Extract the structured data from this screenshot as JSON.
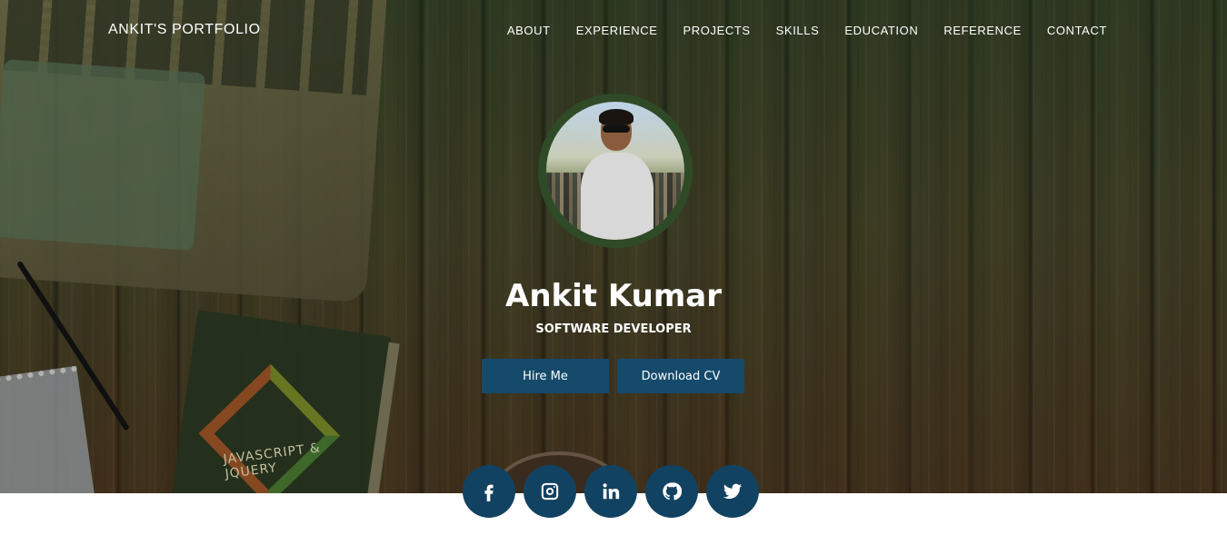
{
  "nav": {
    "brand": "ANKIT'S PORTFOLIO",
    "items": [
      {
        "label": "ABOUT"
      },
      {
        "label": "EXPERIENCE"
      },
      {
        "label": "PROJECTS"
      },
      {
        "label": "SKILLS"
      },
      {
        "label": "EDUCATION"
      },
      {
        "label": "REFERENCE"
      },
      {
        "label": "CONTACT"
      }
    ]
  },
  "profile": {
    "name": "Ankit Kumar",
    "title": "SOFTWARE DEVELOPER"
  },
  "buttons": {
    "hire": "Hire Me",
    "download": "Download CV"
  },
  "book_text": "JAVASCRIPT & JQUERY",
  "socials": [
    {
      "icon": "facebook-icon"
    },
    {
      "icon": "instagram-icon"
    },
    {
      "icon": "linkedin-icon"
    },
    {
      "icon": "github-icon"
    },
    {
      "icon": "twitter-icon"
    }
  ],
  "colors": {
    "accent": "#164a6b",
    "social": "#124261",
    "avatar_ring": "#2f4a26"
  }
}
